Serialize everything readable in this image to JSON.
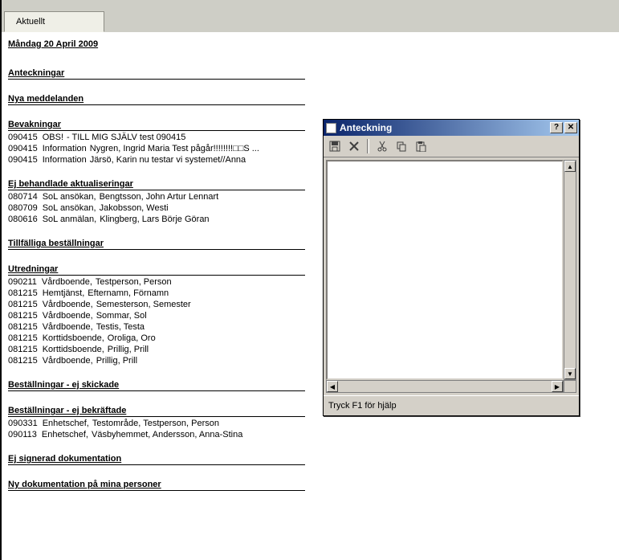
{
  "tab": {
    "label": "Aktuellt"
  },
  "page_date": "Måndag 20 April 2009",
  "sections": {
    "anteckningar": "Anteckningar",
    "nya_meddelanden": "Nya meddelanden",
    "bevakningar": "Bevakningar",
    "ej_behandlade": "Ej behandlade aktualiseringar",
    "tillfalliga": "Tillfälliga beställningar",
    "utredningar": "Utredningar",
    "best_ej_skickade": "Beställningar - ej skickade",
    "best_ej_bekraftade": "Beställningar - ej bekräftade",
    "ej_signerad": "Ej signerad dokumentation",
    "ny_dok": "Ny dokumentation på mina personer"
  },
  "bevakningar": [
    {
      "date": "090415",
      "type": "OBS!",
      "text": "- TILL MIG SJÄLV test 090415"
    },
    {
      "date": "090415",
      "type": "Information",
      "text": "Nygren, Ingrid Maria  Test pågår!!!!!!!!□□S ..."
    },
    {
      "date": "090415",
      "type": "Information",
      "text": "Järsö, Karin  nu testar vi systemet//Anna"
    }
  ],
  "ej_behandlade": [
    {
      "date": "080714",
      "type": "SoL ansökan,",
      "text": "Bengtsson, John Artur Lennart"
    },
    {
      "date": "080709",
      "type": "SoL ansökan,",
      "text": "Jakobsson, Westi"
    },
    {
      "date": "080616",
      "type": "SoL anmälan,",
      "text": "Klingberg, Lars Börje Göran"
    }
  ],
  "utredningar": [
    {
      "date": "090211",
      "type": "Vårdboende,",
      "text": "Testperson, Person"
    },
    {
      "date": "081215",
      "type": "Hemtjänst,",
      "text": "Efternamn, Förnamn"
    },
    {
      "date": "081215",
      "type": "Vårdboende,",
      "text": "Semesterson, Semester"
    },
    {
      "date": "081215",
      "type": "Vårdboende,",
      "text": "Sommar, Sol"
    },
    {
      "date": "081215",
      "type": "Vårdboende,",
      "text": "Testis, Testa"
    },
    {
      "date": "081215",
      "type": "Korttidsboende,",
      "text": "Oroliga, Oro"
    },
    {
      "date": "081215",
      "type": "Korttidsboende,",
      "text": "Prillig, Prill"
    },
    {
      "date": "081215",
      "type": "Vårdboende,",
      "text": "Prillig, Prill"
    }
  ],
  "best_ej_bekraftade": [
    {
      "date": "090331",
      "type": "Enhetschef,",
      "text": "Testområde, Testperson, Person"
    },
    {
      "date": "090113",
      "type": "Enhetschef,",
      "text": "Väsbyhemmet, Andersson, Anna-Stina"
    }
  ],
  "dialog": {
    "title": "Anteckning",
    "status": "Tryck F1 för hjälp"
  }
}
